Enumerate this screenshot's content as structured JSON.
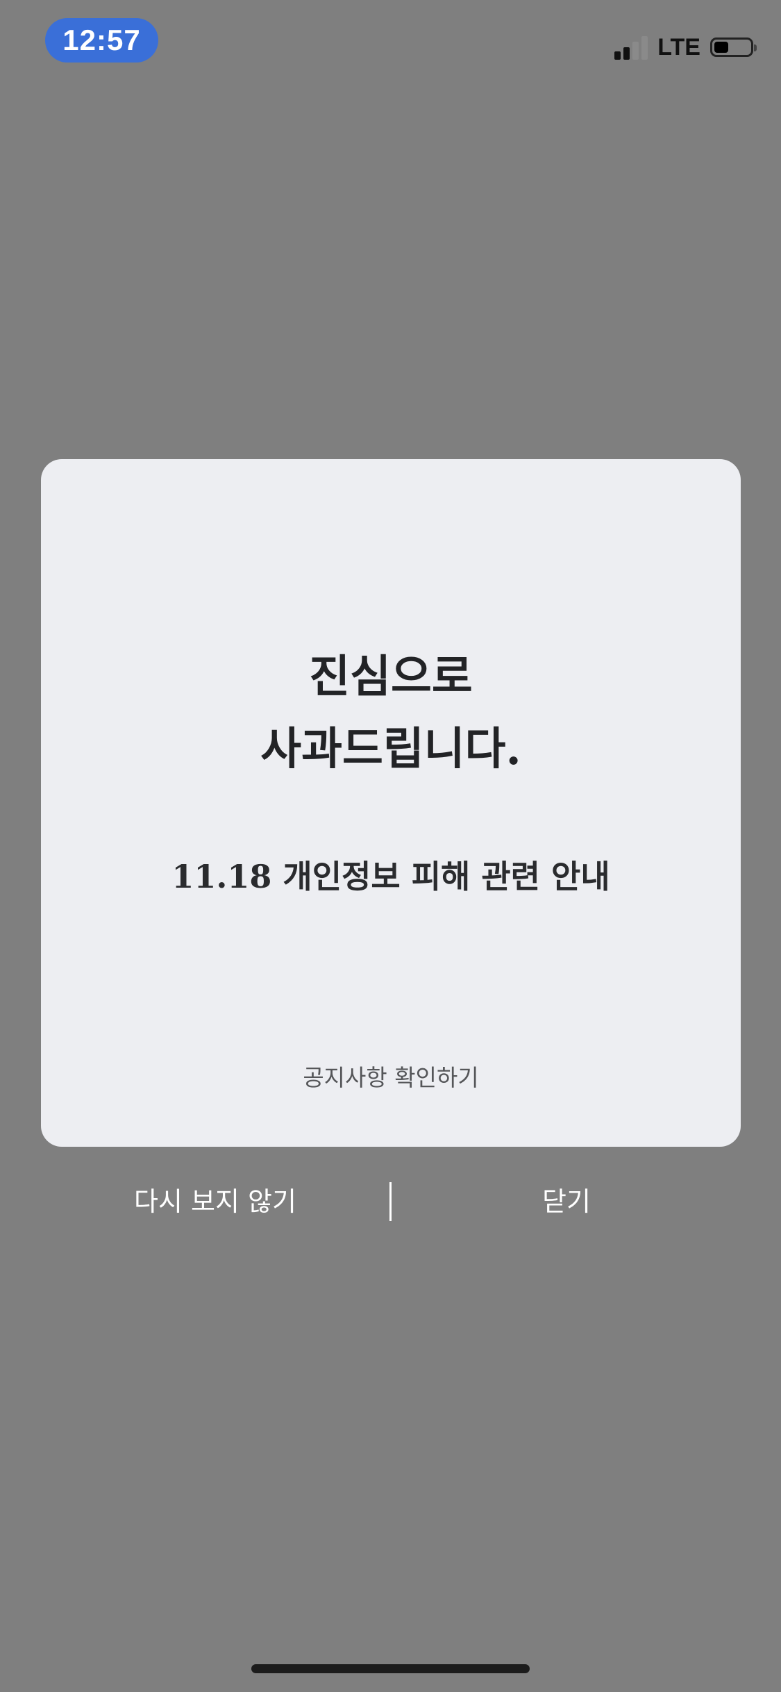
{
  "status_bar": {
    "time": "12:57",
    "network": "LTE",
    "battery_icon": "battery-icon",
    "signal_icon": "cellular-signal-icon"
  },
  "modal": {
    "headline_line1": "진심으로",
    "headline_line2": "사과드립니다.",
    "subtitle": "11.18 개인정보 피해 관련 안내",
    "link_label": "공지사항 확인하기"
  },
  "actions": {
    "dont_show_again": "다시 보지 않기",
    "close": "닫기"
  },
  "colors": {
    "overlay": "#7f7f7f",
    "card": "#edeef2",
    "time_pill": "#3a6fd8",
    "text_dark": "#222326",
    "text_muted": "#555659"
  }
}
